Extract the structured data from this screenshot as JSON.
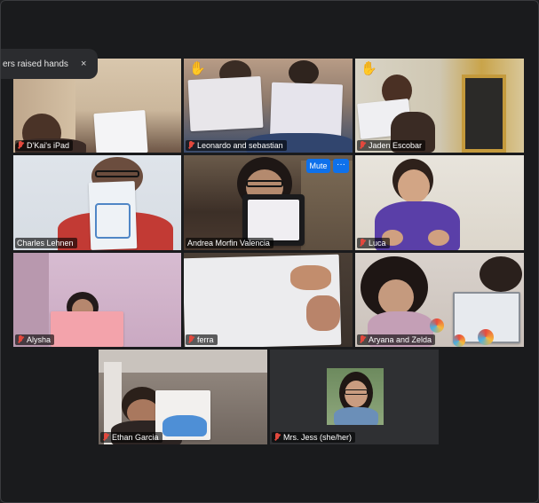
{
  "notification": {
    "text": "ers raised hands",
    "close_icon": "close-icon",
    "close_glyph": "×"
  },
  "tile_controls": {
    "mute_label": "Mute",
    "more_label": "···"
  },
  "participants": [
    {
      "name": "D'Kai's iPad",
      "muted": true,
      "hand_raised": false
    },
    {
      "name": "Leonardo and sebastian",
      "muted": true,
      "hand_raised": true
    },
    {
      "name": "Jaden Escobar",
      "muted": true,
      "hand_raised": true
    },
    {
      "name": "Charles Lehnen",
      "muted": false,
      "hand_raised": false
    },
    {
      "name": "Andrea Morfin Valencia",
      "muted": false,
      "hand_raised": false,
      "active_speaker": true
    },
    {
      "name": "Luca",
      "muted": true,
      "hand_raised": false
    },
    {
      "name": "Alysha",
      "muted": true,
      "hand_raised": false
    },
    {
      "name": "ferra",
      "muted": true,
      "hand_raised": false
    },
    {
      "name": "Aryana and Zelda",
      "muted": true,
      "hand_raised": false
    },
    {
      "name": "Ethan Garcia",
      "muted": true,
      "hand_raised": false
    },
    {
      "name": "Mrs. Jess (she/her)",
      "muted": true,
      "hand_raised": false
    }
  ],
  "icons": {
    "hand": "✋",
    "mic_off": "mic-off-icon"
  },
  "colors": {
    "background": "#1f2022",
    "active_speaker_border": "#d6e04a",
    "mute_button": "#0e71eb",
    "mic_off": "#e2483d"
  }
}
